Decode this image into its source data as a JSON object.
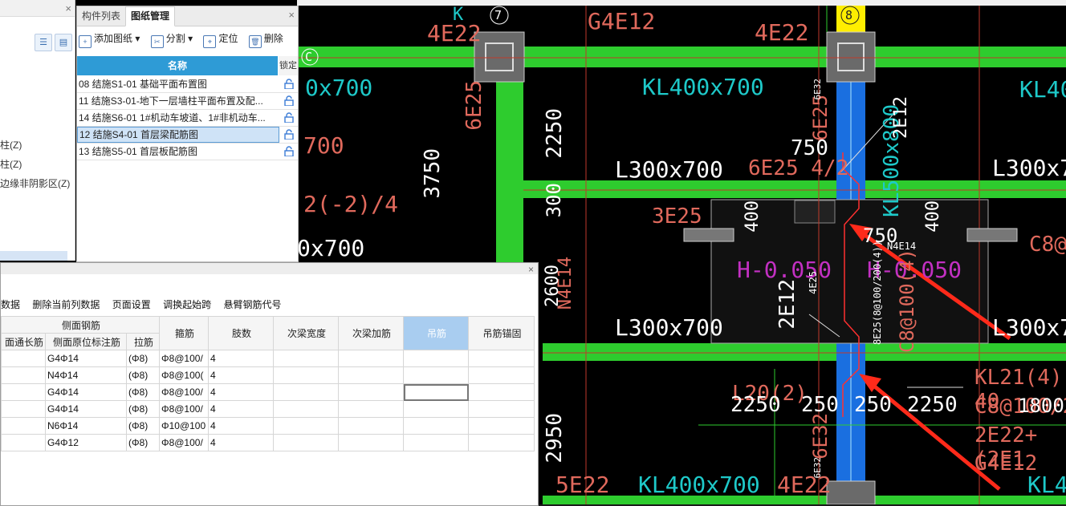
{
  "left_panel": {
    "items": [
      "柱(Z)",
      "柱(Z)",
      "边缘非阴影区(Z)"
    ]
  },
  "drawing_panel": {
    "tabs": [
      "构件列表",
      "图纸管理"
    ],
    "active_tab": "图纸管理",
    "toolbar": {
      "add": "添加图纸",
      "split": "分割",
      "locate": "定位",
      "delete": "删除"
    },
    "header": {
      "name": "名称",
      "lock": "锁定"
    },
    "rows": [
      {
        "name": "08 结施S1-01 基础平面布置图",
        "selected": false
      },
      {
        "name": "11 结施S3-01-地下一层墙柱平面布置及配...",
        "selected": false
      },
      {
        "name": "14 结施S6-01 1#机动车坡道、1#非机动车...",
        "selected": false
      },
      {
        "name": "12 结施S4-01 首层梁配筋图",
        "selected": true
      },
      {
        "name": "13 结施S5-01 首层板配筋图",
        "selected": false
      }
    ]
  },
  "table_panel": {
    "menu": [
      "数据",
      "删除当前列数据",
      "页面设置",
      "调换起始跨",
      "悬臂钢筋代号"
    ],
    "headers": {
      "side_group": "侧面钢筋",
      "side_through": "面通长筋",
      "side_orig": "侧面原位标注筋",
      "tie": "拉筋",
      "stirrup": "箍筋",
      "legs": "肢数",
      "sec_width": "次梁宽度",
      "sec_add": "次梁加筋",
      "hanger": "吊筋",
      "hanger_anchor": "吊筋锚固"
    },
    "rows": [
      {
        "side_orig": "G4Φ14",
        "tie": "(Φ8)",
        "stirrup": "Φ8@100/",
        "legs": "4"
      },
      {
        "side_orig": "N4Φ14",
        "tie": "(Φ8)",
        "stirrup": "Φ8@100(",
        "legs": "4"
      },
      {
        "side_orig": "G4Φ14",
        "tie": "(Φ8)",
        "stirrup": "Φ8@100/",
        "legs": "4"
      },
      {
        "side_orig": "G4Φ14",
        "tie": "(Φ8)",
        "stirrup": "Φ8@100/",
        "legs": "4"
      },
      {
        "side_orig": "N6Φ14",
        "tie": "(Φ8)",
        "stirrup": "Φ10@100",
        "legs": "4"
      },
      {
        "side_orig": "G4Φ12",
        "tie": "(Φ8)",
        "stirrup": "Φ8@100/",
        "legs": "4"
      }
    ]
  },
  "cad": {
    "texts": {
      "t1": "4E22",
      "t2": "G4E12",
      "t3": "4E22",
      "t4": "6E25",
      "t5": "KL400x700",
      "t6": "KL40",
      "t7": "0x700",
      "t8": "6E25",
      "t9": "6E32",
      "t10": "2250",
      "t11": "3750",
      "t12": "L300x700",
      "t13": "6E25 4/2",
      "t14": "750",
      "t15": "KL500x800",
      "t16": "2E12",
      "t17": "L300x70",
      "t18": "700",
      "t19": "300",
      "t20": "2(-2)/4",
      "t21": "3E25",
      "t22": "400",
      "t23": "400",
      "t24": "750",
      "t25": "C8@",
      "t26": "0x700",
      "t27": "H-0.050",
      "t28": "H-0.050",
      "t29": "N4E14",
      "t30": "8E25(8@100/200(4))",
      "t31": "4E25",
      "t32": "2E12",
      "t33": "C8@100(4)",
      "t34": "L300x700",
      "t35": "L300x70",
      "t36": "N4E14",
      "t37": "2600",
      "t38": "L20(2)",
      "t39": "2250",
      "t40": "250",
      "t41": "250",
      "t42": "2250",
      "t43": "KL21(4) 40",
      "t44": "C8@100/20",
      "t45": "2E22+(2E1",
      "t46": "G4E12",
      "t47": "1800",
      "t48": "2950",
      "t49": "5E22",
      "t50": "KL400x700",
      "t51": "4E22",
      "t52": "6E32",
      "t53": "KL40",
      "t54": "6E32",
      "t55": "K"
    },
    "axis_labels": [
      "7",
      "8",
      "C"
    ]
  }
}
